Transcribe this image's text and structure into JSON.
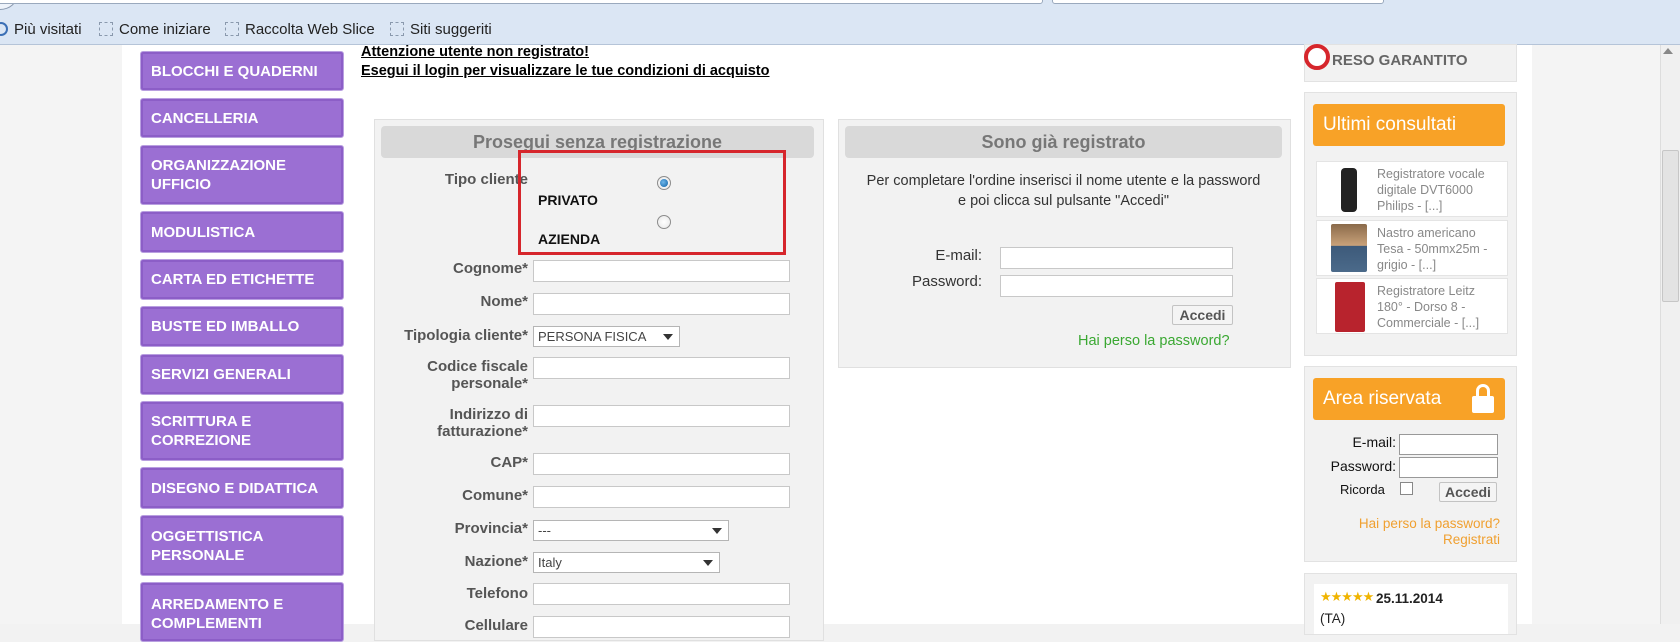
{
  "favorites": [
    "Più visitati",
    "Come iniziare",
    "Raccolta Web Slice",
    "Siti suggeriti"
  ],
  "menu": [
    "BLOCCHI E QUADERNI",
    "CANCELLERIA",
    "ORGANIZZAZIONE UFFICIO",
    "MODULISTICA",
    "CARTA ED ETICHETTE",
    "BUSTE ED IMBALLO",
    "SERVIZI GENERALI",
    "SCRITTURA E CORREZIONE",
    "DISEGNO E DIDATTICA",
    "OGGETTISTICA PERSONALE",
    "ARREDAMENTO E COMPLEMENTI"
  ],
  "notice": {
    "line1": "Attenzione utente non registrato!",
    "line2": "Esegui il login per visualizzare le tue condizioni di acquisto"
  },
  "guest": {
    "title": "Prosegui senza registrazione",
    "tipo_cliente": "Tipo cliente",
    "privato": "PRIVATO",
    "azienda": "AZIENDA",
    "cognome": "Cognome*",
    "nome": "Nome*",
    "tipologia": "Tipologia cliente*",
    "tipologia_value": "PERSONA FISICA",
    "codice_fiscale_1": "Codice fiscale",
    "codice_fiscale_2": "personale*",
    "indirizzo_1": "Indirizzo di",
    "indirizzo_2": "fatturazione*",
    "cap": "CAP*",
    "comune": "Comune*",
    "provincia": "Provincia*",
    "provincia_value": "---",
    "nazione": "Nazione*",
    "nazione_value": "Italy",
    "telefono": "Telefono",
    "cellulare": "Cellulare"
  },
  "registered": {
    "title": "Sono già registrato",
    "desc_1": "Per completare l'ordine inserisci il nome utente e la password",
    "desc_2": "e poi clicca sul pulsante \"Accedi\"",
    "email": "E-mail:",
    "password": "Password:",
    "accedi": "Accedi",
    "lost": "Hai perso la password?"
  },
  "sidebar": {
    "reso": "RESO GARANTITO",
    "recent_title": "Ultimi consultati",
    "recent": [
      "Registratore vocale digitale DVT6000 Philips - [...]",
      "Nastro americano Tesa - 50mmx25m - grigio - [...]",
      "Registratore Leitz 180° - Dorso 8 - Commerciale - [...]"
    ],
    "area_title": "Area riservata",
    "email": "E-mail:",
    "password": "Password:",
    "ricorda": "Ricorda",
    "accedi": "Accedi",
    "lost": "Hai perso la password?",
    "registrati": "Registrati",
    "review_date": "25.11.2014",
    "review_who": "(TA)"
  },
  "colors": {
    "menu": "#9b6fd3",
    "accent_orange": "#f8a227",
    "link_green": "#3aa832",
    "highlight_red": "#d6262c"
  }
}
